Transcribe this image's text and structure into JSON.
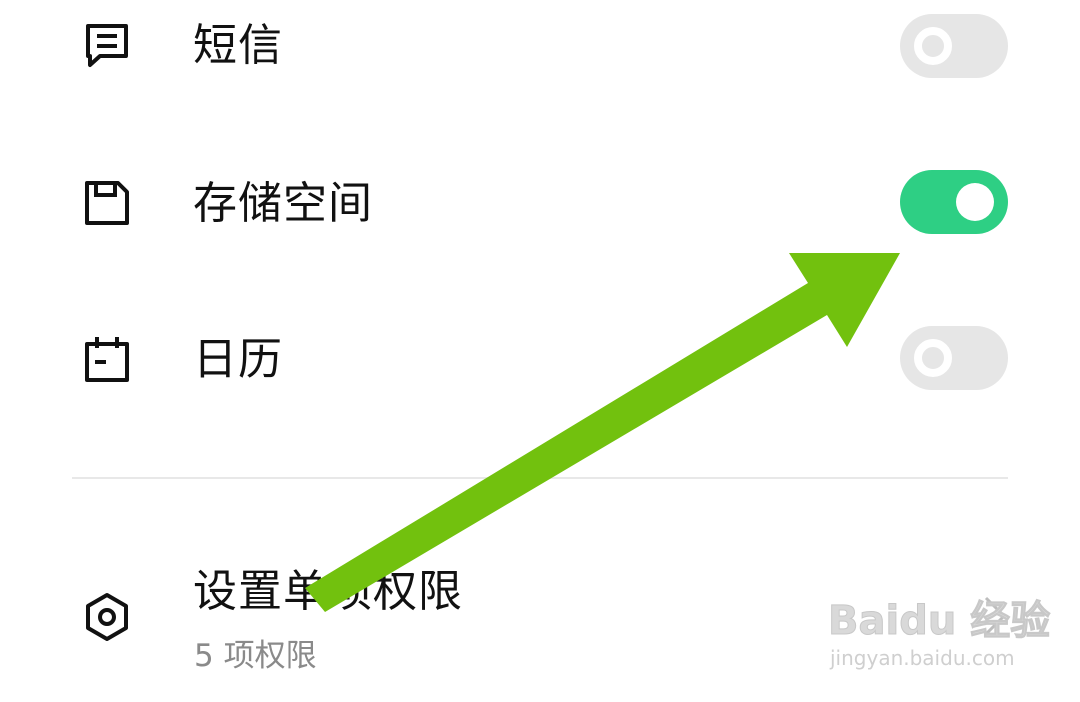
{
  "permissions": [
    {
      "label": "短信",
      "icon": "message-icon",
      "enabled": false
    },
    {
      "label": "存储空间",
      "icon": "storage-icon",
      "enabled": true
    },
    {
      "label": "日历",
      "icon": "calendar-icon",
      "enabled": false
    }
  ],
  "single_permission": {
    "title": "设置单项权限",
    "subtitle": "5 项权限",
    "icon": "hexagon-settings-icon"
  },
  "watermark": {
    "brand": "Baidu 经验",
    "url": "jingyan.baidu.com"
  },
  "colors": {
    "toggle_on": "#2ecf84",
    "toggle_off": "#e6e6e6",
    "annotation_arrow": "#72c10e",
    "subtitle": "#8a8a8a"
  }
}
